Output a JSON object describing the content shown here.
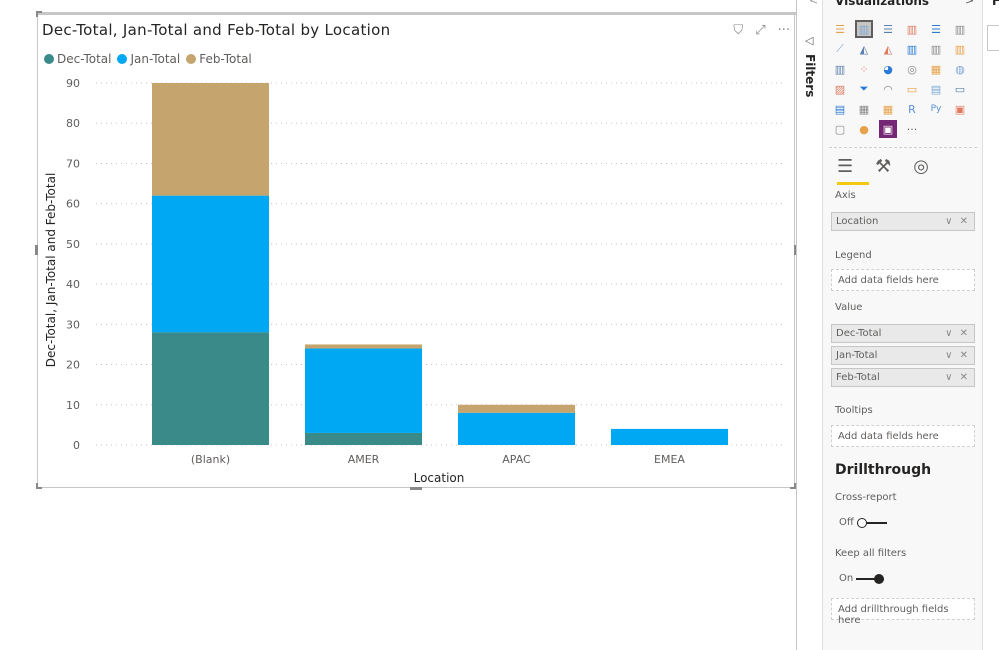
{
  "visual": {
    "icons": [
      "filter-icon",
      "focus-mode-icon",
      "more-options-icon"
    ],
    "more_glyph": "···",
    "filter_glyph": "⛉",
    "focus_glyph": "⤢"
  },
  "chart_data": {
    "type": "bar",
    "stacked": true,
    "title": "Dec-Total, Jan-Total and Feb-Total by Location",
    "xlabel": "Location",
    "ylabel": "Dec-Total, Jan-Total and Feb-Total",
    "categories": [
      "(Blank)",
      "AMER",
      "APAC",
      "EMEA"
    ],
    "series": [
      {
        "name": "Dec-Total",
        "color": "#3A8A8A",
        "values": [
          28,
          3,
          0,
          0
        ]
      },
      {
        "name": "Jan-Total",
        "color": "#00A8F3",
        "values": [
          34,
          21,
          8,
          4
        ]
      },
      {
        "name": "Feb-Total",
        "color": "#C6A46E",
        "values": [
          28,
          1,
          2,
          0
        ]
      }
    ],
    "ylim": [
      0,
      90
    ],
    "yticks": [
      0,
      10,
      20,
      30,
      40,
      50,
      60,
      70,
      80,
      90
    ],
    "grid": true,
    "legend_position": "top-left"
  },
  "filters_pane": {
    "label": "Filters",
    "icon_glyph": "◁"
  },
  "viz_pane": {
    "title": "Visualizations",
    "chevron": ">",
    "collapse": "<",
    "icon_rows": [
      [
        "stacked-bar",
        "stacked-column",
        "clustered-bar",
        "clustered-column",
        "100-stacked-bar",
        "100-stacked-column"
      ],
      [
        "line",
        "area",
        "stacked-area",
        "line-clustered-column",
        "line-stacked-column",
        "ribbon"
      ],
      [
        "waterfall",
        "scatter",
        "pie",
        "donut",
        "treemap",
        "map"
      ],
      [
        "filled-map",
        "funnel",
        "gauge",
        "card",
        "multi-row-card",
        "kpi"
      ],
      [
        "slicer",
        "table",
        "matrix",
        "r-visual",
        "python-visual",
        "key-influencers"
      ],
      [
        "qna",
        "arcgis",
        "power-apps",
        "more"
      ]
    ],
    "icon_glyphs": {
      "stacked-bar": "☰",
      "stacked-column": "▥",
      "clustered-bar": "☰",
      "clustered-column": "▥",
      "100-stacked-bar": "☰",
      "100-stacked-column": "▥",
      "line": "⟋",
      "area": "◭",
      "stacked-area": "◭",
      "line-clustered-column": "▥",
      "line-stacked-column": "▥",
      "ribbon": "▥",
      "waterfall": "▥",
      "scatter": "⁘",
      "pie": "◕",
      "donut": "◎",
      "treemap": "▦",
      "map": "◍",
      "filled-map": "▨",
      "funnel": "⏷",
      "gauge": "◠",
      "card": "▭",
      "multi-row-card": "▤",
      "kpi": "▭",
      "slicer": "▤",
      "table": "▦",
      "matrix": "▦",
      "r-visual": "R",
      "python-visual": "Py",
      "key-influencers": "▣",
      "qna": "▢",
      "arcgis": "●",
      "power-apps": "▣",
      "more": "···"
    },
    "tabs": [
      {
        "name": "fields-tab",
        "glyph": "☰"
      },
      {
        "name": "format-tab",
        "glyph": "⚒"
      },
      {
        "name": "analytics-tab",
        "glyph": "◎"
      }
    ],
    "wells": {
      "axis_label": "Axis",
      "axis_fields": [
        "Location"
      ],
      "legend_label": "Legend",
      "legend_placeholder": "Add data fields here",
      "value_label": "Value",
      "value_fields": [
        "Dec-Total",
        "Jan-Total",
        "Feb-Total"
      ],
      "tooltips_label": "Tooltips",
      "tooltips_placeholder": "Add data fields here",
      "field_actions": "∨ ✕"
    },
    "drillthrough": {
      "title": "Drillthrough",
      "cross_report_label": "Cross-report",
      "cross_report_state": "Off",
      "keep_filters_label": "Keep all filters",
      "keep_filters_state": "On",
      "placeholder": "Add drillthrough fields here"
    }
  },
  "fields_pane": {
    "title": "F"
  }
}
